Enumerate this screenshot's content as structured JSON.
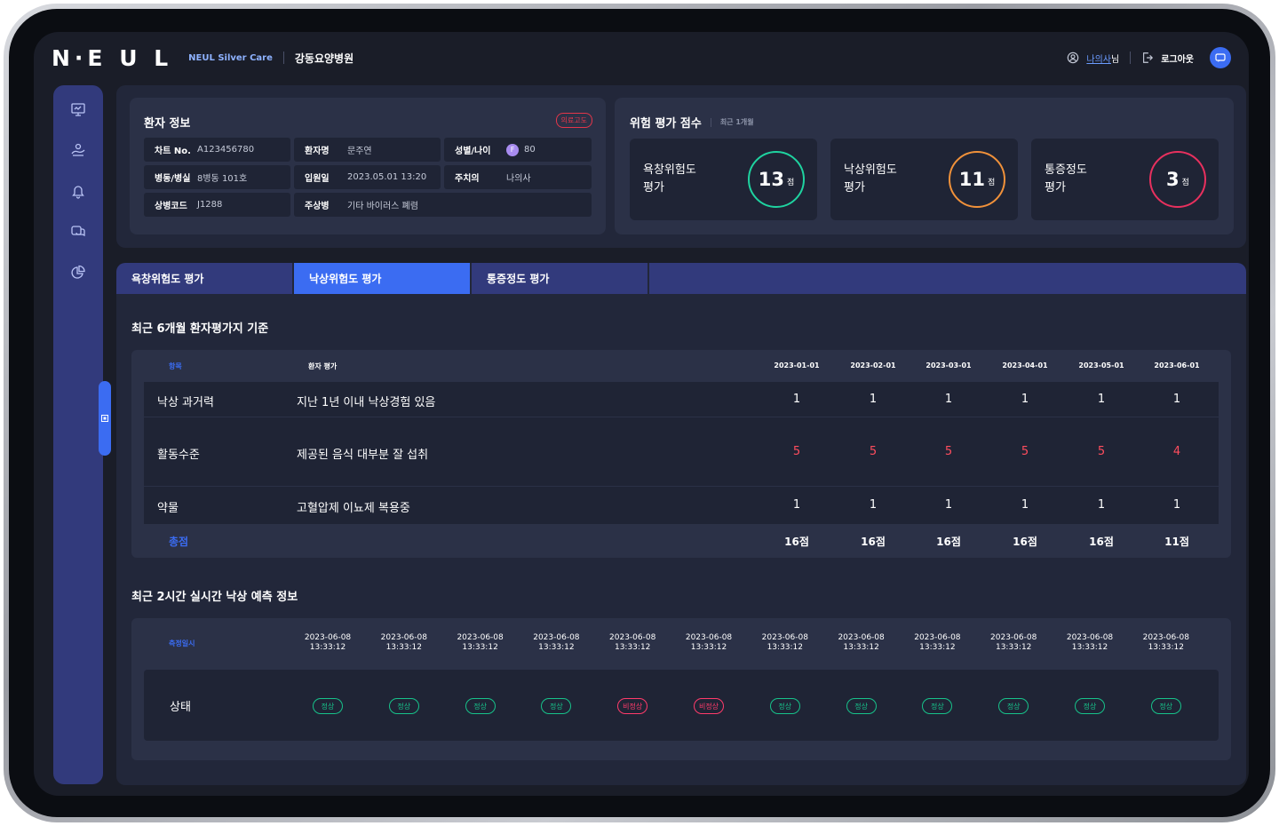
{
  "header": {
    "logo": "N·E U L",
    "brand_sub": "NEUL Silver Care",
    "hospital": "강동요양병원",
    "user_name": "나의사",
    "user_suffix": "님",
    "logout": "로그아웃"
  },
  "sidebar": {
    "icons": [
      "monitor-icon",
      "care-hand-icon",
      "bell-icon",
      "consult-icon",
      "chart-pie-icon"
    ]
  },
  "patient": {
    "title": "환자 정보",
    "badge": "의료고도",
    "rows": [
      [
        {
          "k": "차트 No.",
          "v": "A123456780"
        },
        {
          "k": "환자명",
          "v": "문주연"
        },
        {
          "k": "성별/나이",
          "v": "80",
          "gender": "F"
        }
      ],
      [
        {
          "k": "병동/병실",
          "v": "8병동 101호"
        },
        {
          "k": "입원일",
          "v": "2023.05.01 13:20"
        },
        {
          "k": "주치의",
          "v": "나의사"
        }
      ],
      [
        {
          "k": "상병코드",
          "v": "J1288"
        },
        {
          "k": "주상병",
          "v": "기타 바이러스 폐렴"
        }
      ]
    ]
  },
  "risk": {
    "title": "위험 평가 점수",
    "subtitle": "최근 1개월",
    "unit": "점",
    "scores": [
      {
        "label1": "욕창위험도",
        "label2": "평가",
        "value": "13",
        "color": "#1fd3a0"
      },
      {
        "label1": "낙상위험도",
        "label2": "평가",
        "value": "11",
        "color": "#f0913a"
      },
      {
        "label1": "통증정도",
        "label2": "평가",
        "value": "3",
        "color": "#e8305e"
      }
    ]
  },
  "tabs": [
    "욕창위험도 평가",
    "낙상위험도 평가",
    "통증정도 평가"
  ],
  "assessment": {
    "title": "최근 6개월 환자평가지 기준",
    "col_item": "항목",
    "col_eval": "환자 평가",
    "dates": [
      "2023-01-01",
      "2023-02-01",
      "2023-03-01",
      "2023-04-01",
      "2023-05-01",
      "2023-06-01"
    ],
    "rows": [
      {
        "item": "낙상 과거력",
        "eval": "지난 1년 이내 낙상경험 있음",
        "values": [
          "1",
          "1",
          "1",
          "1",
          "1",
          "1"
        ]
      },
      {
        "item": "활동수준",
        "eval": "제공된 음식 대부분 잘 섭취",
        "values": [
          "5",
          "5",
          "5",
          "5",
          "5",
          "4"
        ]
      },
      {
        "item": "약물",
        "eval": "고혈압제 이뇨제 복용중",
        "values": [
          "1",
          "1",
          "1",
          "1",
          "1",
          "1"
        ]
      }
    ],
    "total_label": "총점",
    "totals": [
      "16점",
      "16점",
      "16점",
      "16점",
      "16점",
      "11점"
    ]
  },
  "prediction": {
    "title": "최근 2시간 실시간 낙상 예측 정보",
    "col_label": "측정일시",
    "row_label": "상태",
    "times": [
      {
        "date": "2023-06-08",
        "time": "13:33:12",
        "status": "정상",
        "ok": true
      },
      {
        "date": "2023-06-08",
        "time": "13:33:12",
        "status": "정상",
        "ok": true
      },
      {
        "date": "2023-06-08",
        "time": "13:33:12",
        "status": "정상",
        "ok": true
      },
      {
        "date": "2023-06-08",
        "time": "13:33:12",
        "status": "정상",
        "ok": true
      },
      {
        "date": "2023-06-08",
        "time": "13:33:12",
        "status": "비정상",
        "ok": false
      },
      {
        "date": "2023-06-08",
        "time": "13:33:12",
        "status": "비정상",
        "ok": false
      },
      {
        "date": "2023-06-08",
        "time": "13:33:12",
        "status": "정상",
        "ok": true
      },
      {
        "date": "2023-06-08",
        "time": "13:33:12",
        "status": "정상",
        "ok": true
      },
      {
        "date": "2023-06-08",
        "time": "13:33:12",
        "status": "정상",
        "ok": true
      },
      {
        "date": "2023-06-08",
        "time": "13:33:12",
        "status": "정상",
        "ok": true
      },
      {
        "date": "2023-06-08",
        "time": "13:33:12",
        "status": "정상",
        "ok": true
      },
      {
        "date": "2023-06-08",
        "time": "13:33:12",
        "status": "정상",
        "ok": true
      }
    ]
  },
  "colors": {
    "accent": "#3b6cf2",
    "alert_red": "#ff4d5e",
    "ok_green": "#17c28a",
    "bad_pink": "#ff3b6b"
  }
}
